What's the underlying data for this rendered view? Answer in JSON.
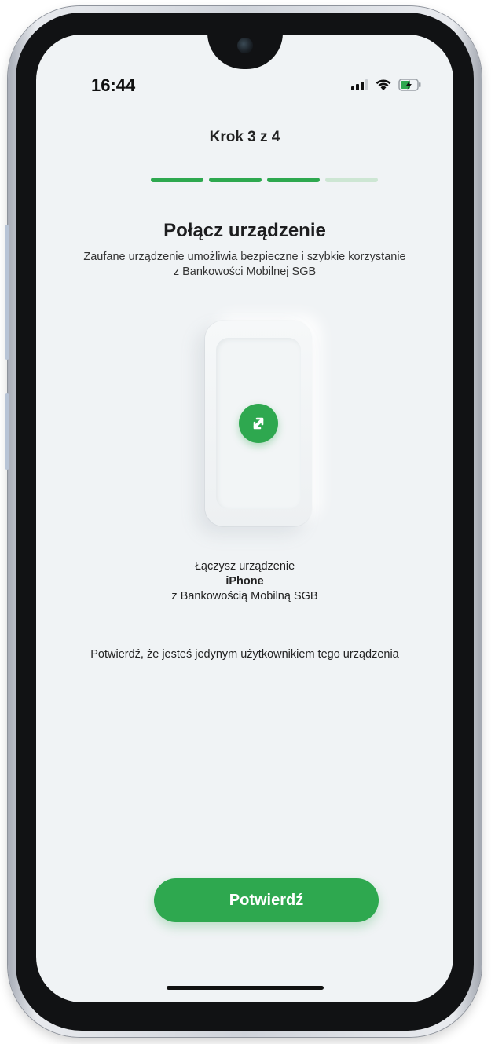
{
  "status_bar": {
    "time": "16:44",
    "icons": [
      "signal-icon",
      "wifi-icon",
      "battery-charging-icon"
    ]
  },
  "step": {
    "label": "Krok 3 z 4",
    "current": 3,
    "total": 4
  },
  "title": "Połącz urządzenie",
  "subtitle": "Zaufane urządzenie umożliwia bezpieczne i szybkie korzystanie z Bankowości Mobilnej SGB",
  "illustration": {
    "icon": "sync-arrows-icon"
  },
  "info": {
    "line1": "Łączysz urządzenie",
    "device_name": "iPhone",
    "line2": "z Bankowością Mobilną SGB"
  },
  "confirm_text": "Potwierdź, że jesteś jedynym użytkownikiem tego urządzenia",
  "confirm_button": "Potwierdź",
  "colors": {
    "accent": "#2ea84f",
    "accent_light": "#cde6d3",
    "background": "#f0f3f5"
  }
}
